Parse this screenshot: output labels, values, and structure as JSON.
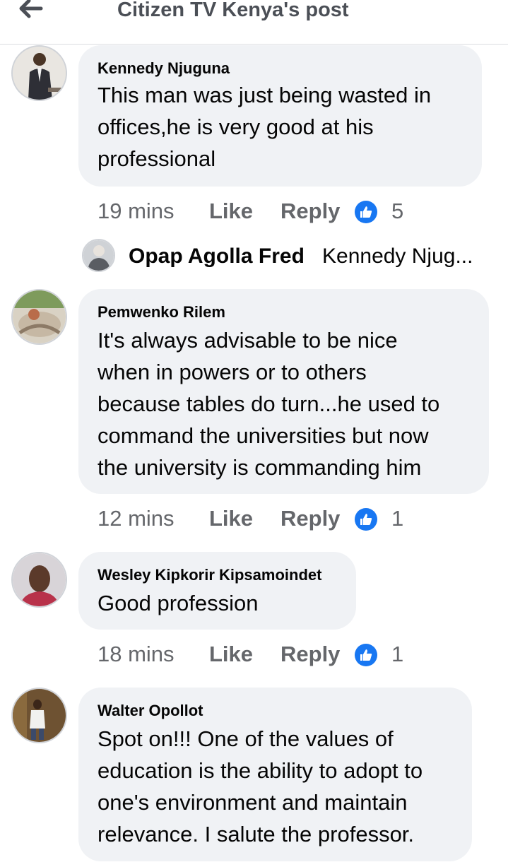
{
  "header": {
    "title": "Citizen TV Kenya's post"
  },
  "comments": [
    {
      "author": "Kennedy Njuguna",
      "lines": [
        "This man was just being wasted in",
        "offices,he is very good at his",
        "professional"
      ],
      "time": "19 mins",
      "like_label": "Like",
      "reply_label": "Reply",
      "reactions": "5"
    },
    {
      "author": "Pemwenko Rilem",
      "lines": [
        "It's always advisable to be nice",
        "when in powers or to others",
        "because tables do turn...he used to",
        "command the universities but now",
        "the university is commanding him"
      ],
      "time": "12 mins",
      "like_label": "Like",
      "reply_label": "Reply",
      "reactions": "1"
    },
    {
      "author": "Wesley Kipkorir Kipsamoindet",
      "lines": [
        "Good profession"
      ],
      "time": "18 mins",
      "like_label": "Like",
      "reply_label": "Reply",
      "reactions": "1"
    },
    {
      "author": "Walter Opollot",
      "lines": [
        "Spot on!!! One of the values of",
        "education is the ability to adopt to",
        "one's environment and maintain",
        "relevance. I salute the professor."
      ]
    }
  ],
  "reply_preview": {
    "author": "Opap Agolla Fred",
    "snippet": "Kennedy Njug..."
  },
  "colors": {
    "like_badge": "#1877f2",
    "bubble": "#f0f2f5",
    "meta_text": "#65676b"
  }
}
